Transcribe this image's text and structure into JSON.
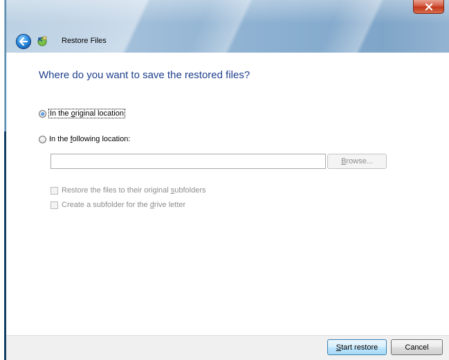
{
  "window": {
    "title": "Restore Files"
  },
  "content": {
    "heading": "Where do you want to save the restored files?",
    "options": {
      "original": {
        "pre": "In the ",
        "accel": "o",
        "post": "riginal location",
        "selected": true
      },
      "following": {
        "pre": "In the ",
        "accel": "f",
        "post": "ollowing location:",
        "selected": false
      }
    },
    "location_input": {
      "value": "",
      "placeholder": ""
    },
    "browse": {
      "accel": "B",
      "rest": "rowse..."
    },
    "checkboxes": {
      "subfolders": {
        "pre": "Restore the files to their original ",
        "accel": "s",
        "post": "ubfolders",
        "checked": false
      },
      "drive": {
        "pre": "Create a subfolder for the ",
        "accel": "d",
        "post": "rive letter",
        "checked": false
      }
    }
  },
  "footer": {
    "start": {
      "accel": "S",
      "rest": "tart restore"
    },
    "cancel": "Cancel"
  },
  "colors": {
    "heading": "#1e3f8c",
    "disabled_text": "#8d8d8d",
    "close_button": "#c33719"
  },
  "icons": {
    "back": "back-arrow-icon",
    "app": "restore-files-icon",
    "close": "close-icon"
  }
}
